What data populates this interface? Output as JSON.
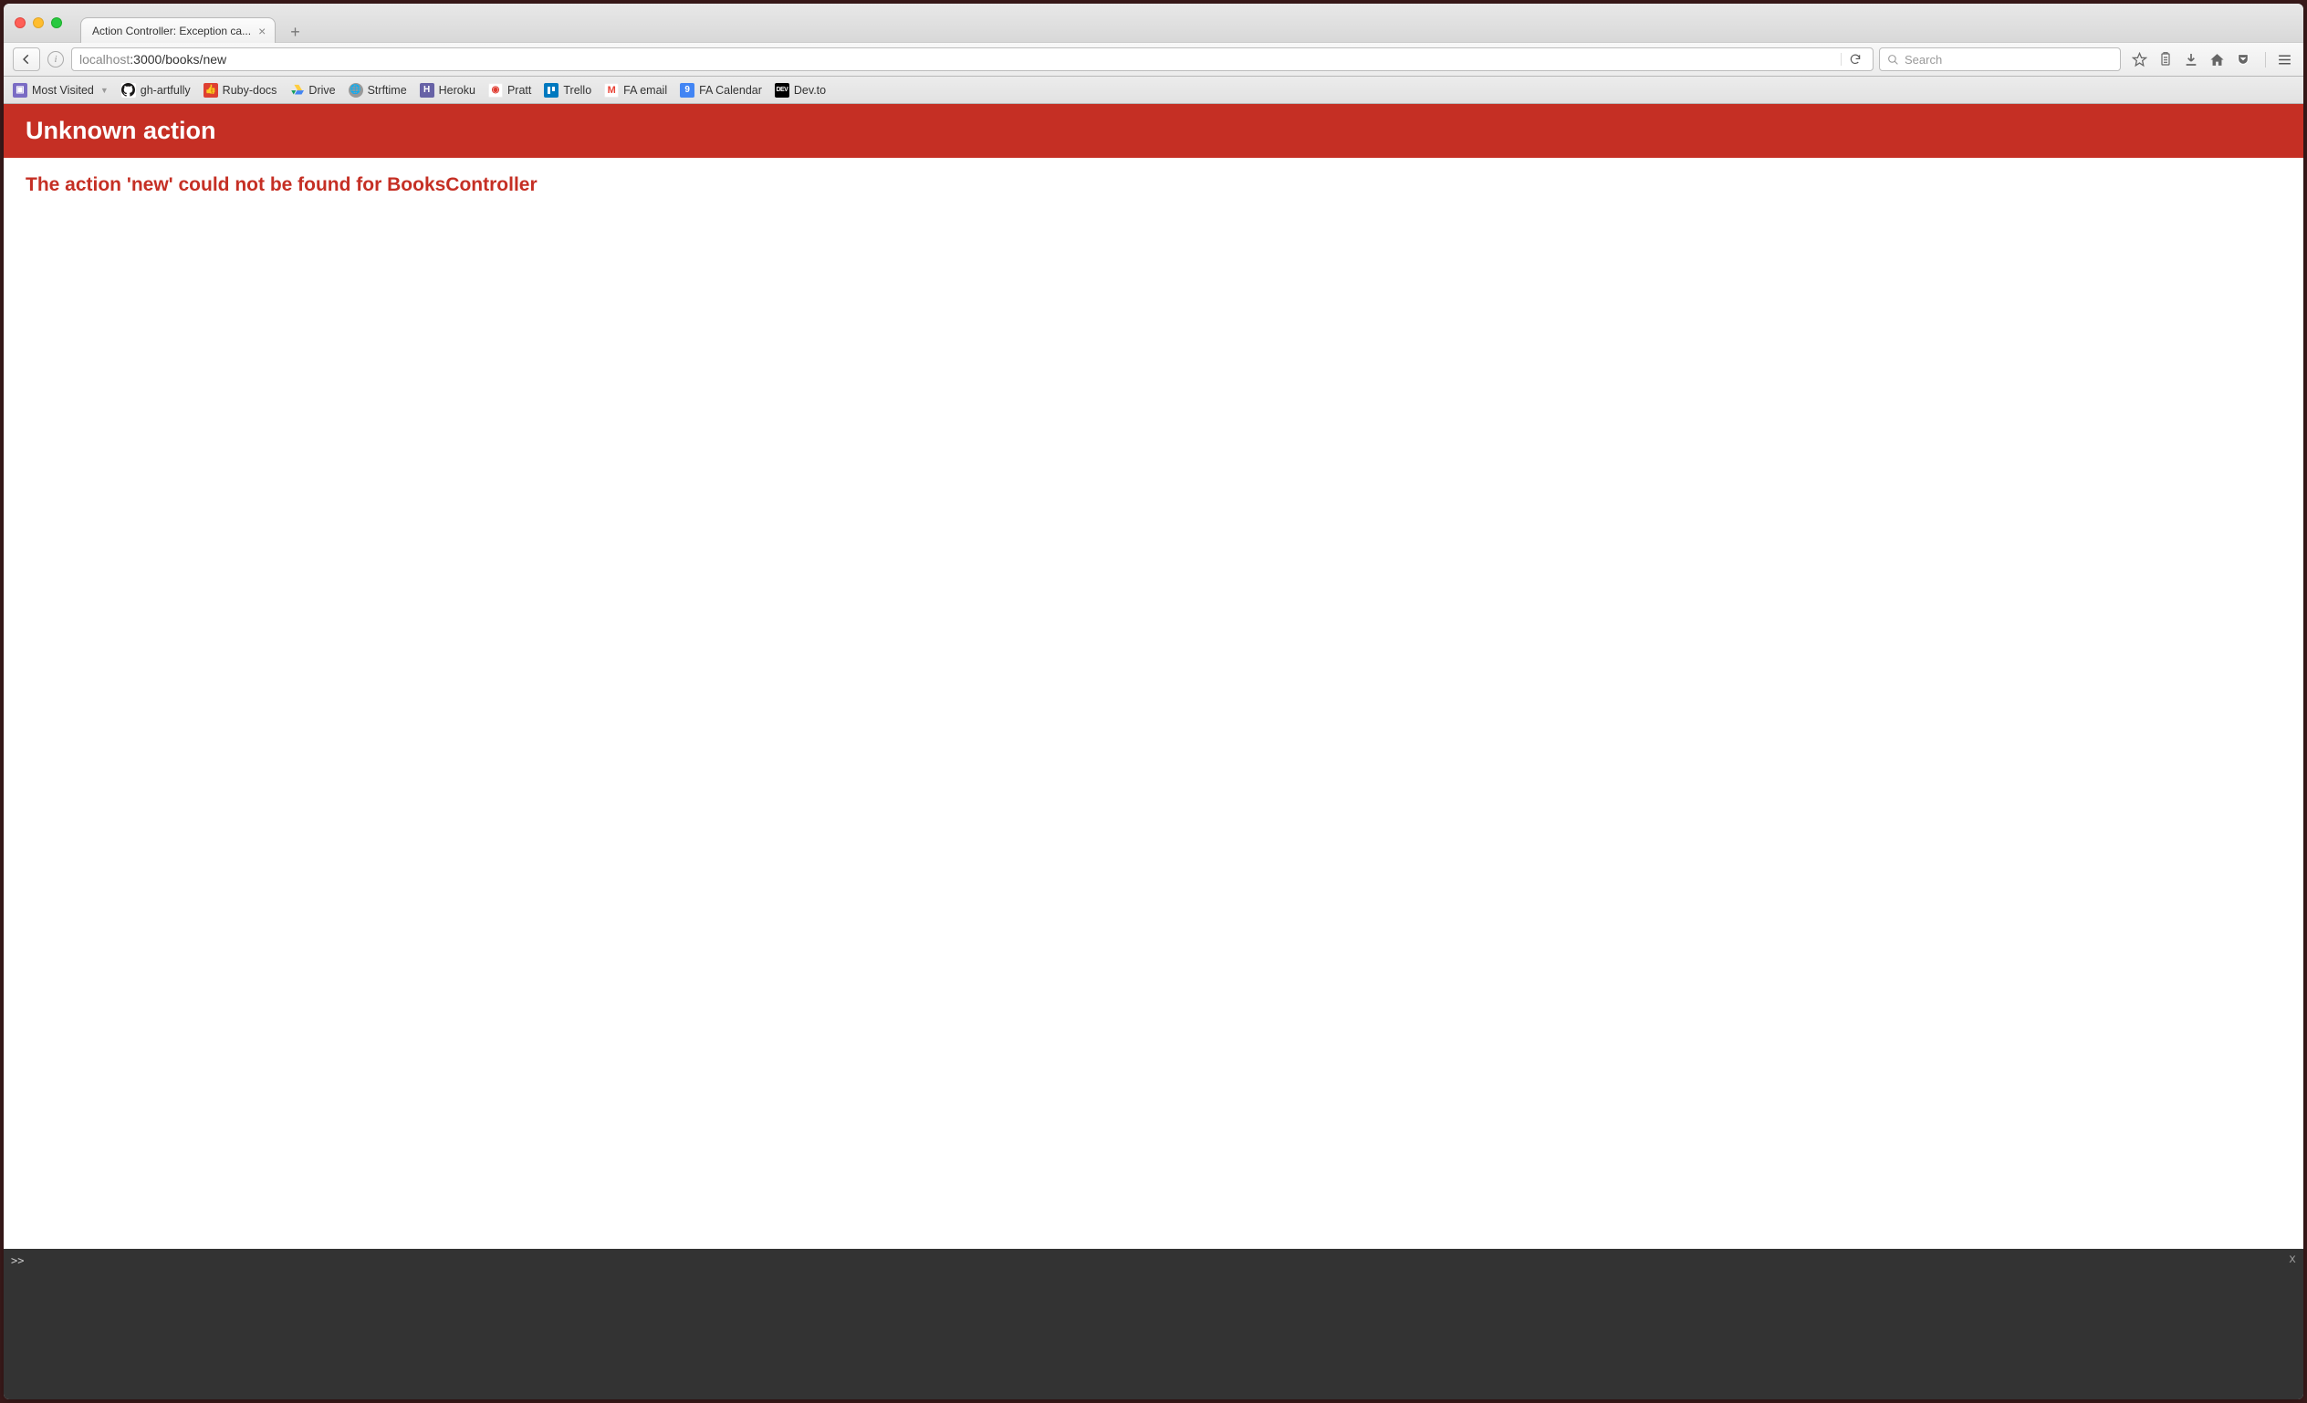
{
  "window": {
    "tab_title": "Action Controller: Exception ca...",
    "new_tab_label": "+"
  },
  "navbar": {
    "url_host": "localhost",
    "url_port_path": ":3000/books/new",
    "search_placeholder": "Search",
    "info_glyph": "i"
  },
  "bookmarks": [
    {
      "label": "Most Visited",
      "icon_bg": "#6b5bd4",
      "glyph": "📁",
      "dropdown": true
    },
    {
      "label": "gh-artfully",
      "icon_bg": "#fff",
      "glyph": "gh"
    },
    {
      "label": "Ruby-docs",
      "icon_bg": "#e03c31",
      "glyph": "◆"
    },
    {
      "label": "Drive",
      "icon_bg": "#fff",
      "glyph": "▲"
    },
    {
      "label": "Strftime",
      "icon_bg": "#aaa",
      "glyph": "●"
    },
    {
      "label": "Heroku",
      "icon_bg": "#6762a6",
      "glyph": "H"
    },
    {
      "label": "Pratt",
      "icon_bg": "#e03c31",
      "glyph": "◉"
    },
    {
      "label": "Trello",
      "icon_bg": "#0079bf",
      "glyph": "▦"
    },
    {
      "label": "FA email",
      "icon_bg": "#fff",
      "glyph": "M"
    },
    {
      "label": "FA Calendar",
      "icon_bg": "#4285f4",
      "glyph": "9"
    },
    {
      "label": "Dev.to",
      "icon_bg": "#000",
      "glyph": "DEV"
    }
  ],
  "error": {
    "header": "Unknown action",
    "message": "The action 'new' could not be found for BooksController"
  },
  "console": {
    "prompt": ">>",
    "close_glyph": "x"
  }
}
